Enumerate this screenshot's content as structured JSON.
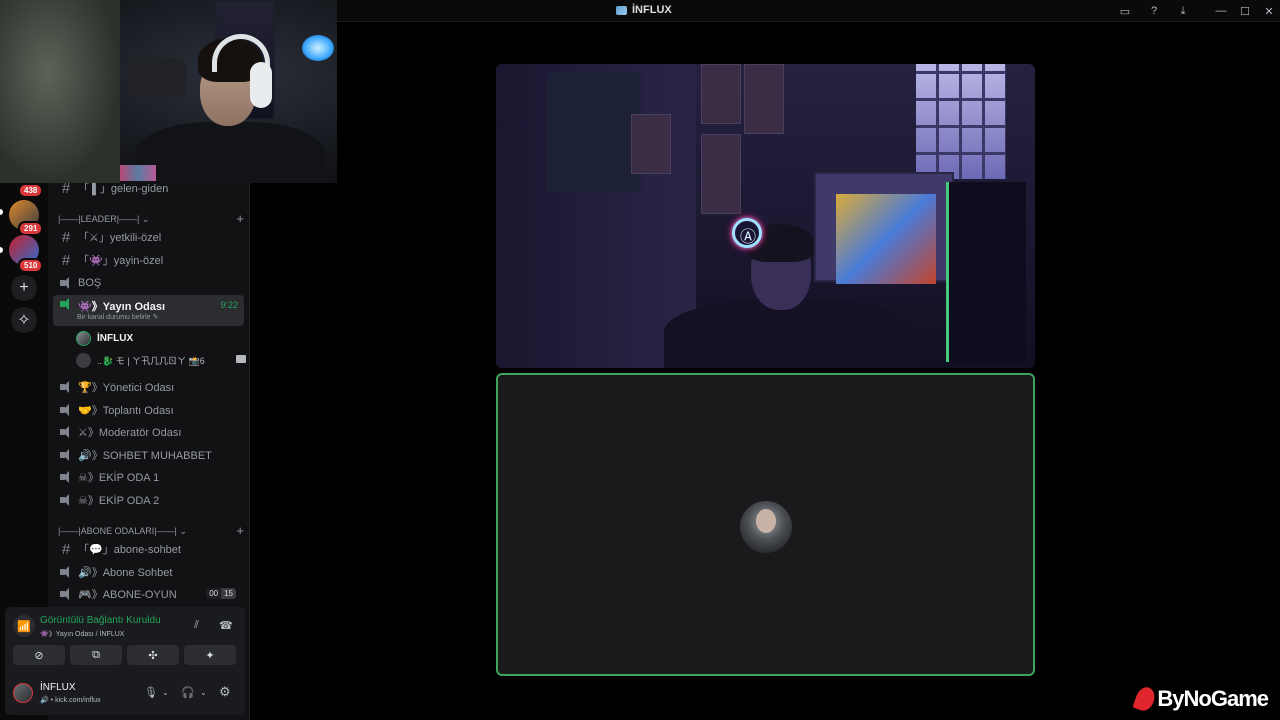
{
  "window": {
    "title": "İNFLUX"
  },
  "rail": {
    "badges": [
      "438",
      "291",
      "510"
    ]
  },
  "sidebar": {
    "top_channel": "「 ▌」gelen-giden",
    "categories": [
      {
        "label": "|——|LEADER|——| ⌄"
      },
      {
        "label": "|——|ABONE ODALARI|——| ⌄"
      }
    ],
    "leader_channels": [
      {
        "type": "text",
        "label": "「⚔」yetkili-özel"
      },
      {
        "type": "text",
        "label": "「👾」yayin-özel"
      },
      {
        "type": "voice",
        "label": "BOŞ"
      }
    ],
    "active_channel": {
      "label": "👾》Yayın Odası",
      "timer": "9:22",
      "status": "Bir kanal durumu belirle ✎"
    },
    "members": [
      {
        "name": "İNFLUX"
      },
      {
        "name": "..🐉 モ | ㄚ卂几几ㄖㄚ 📸6"
      }
    ],
    "voice_channels": [
      {
        "label": "🏆》Yönetici Odası"
      },
      {
        "label": "🤝》Toplantı Odası"
      },
      {
        "label": "⚔》Moderatör Odası"
      },
      {
        "label": "🔊》SOHBET MUHABBET"
      },
      {
        "label": "☠》EKİP ODA 1"
      },
      {
        "label": "☠》EKİP ODA 2"
      }
    ],
    "abone_channels": [
      {
        "type": "text",
        "label": "「💬」abone-sohbet"
      },
      {
        "type": "voice",
        "label": "🔊》Abone Sohbet"
      },
      {
        "type": "voice",
        "label": "🎮》ABONE-OYUN",
        "count_a": "00",
        "count_b": "15"
      }
    ]
  },
  "voice_panel": {
    "title": "Görüntülü Bağlantı Kuruldu",
    "subtitle": "👾》Yayın Odası / İNFLUX"
  },
  "user": {
    "name": "İNFLUX",
    "status": "kick.com/influx"
  },
  "watermark": "ByNoGame"
}
